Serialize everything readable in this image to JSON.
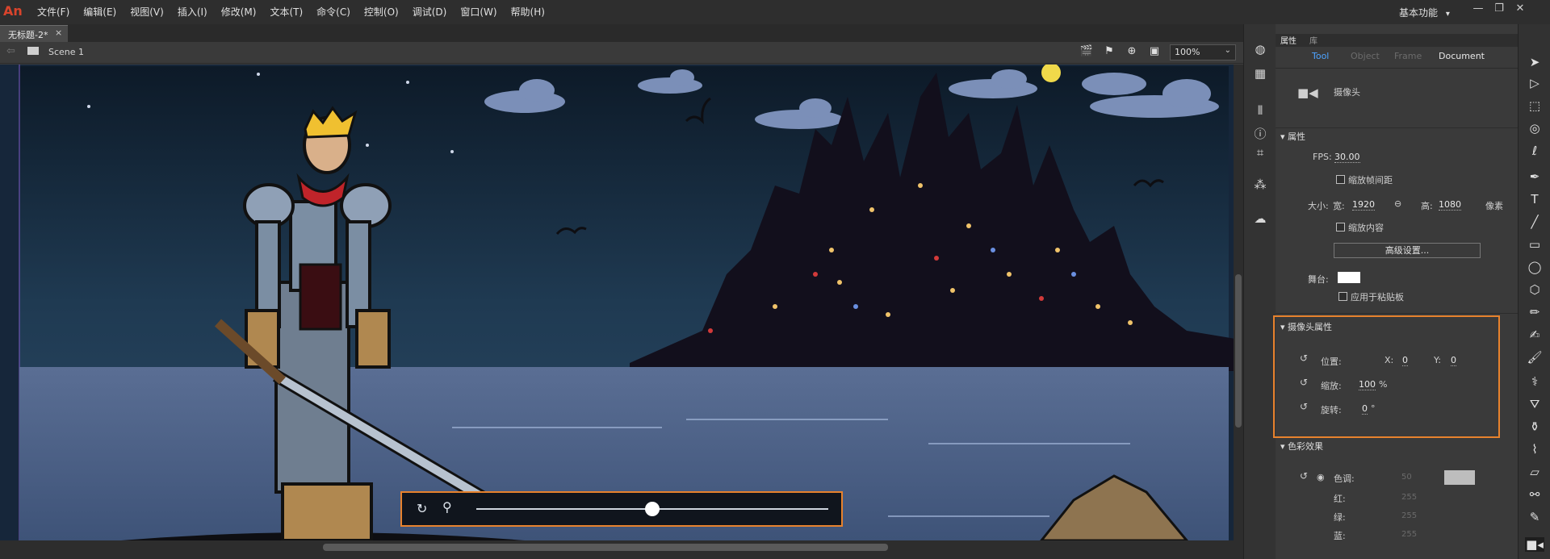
{
  "app": {
    "logo": "An"
  },
  "menu": [
    "文件(F)",
    "编辑(E)",
    "视图(V)",
    "插入(I)",
    "修改(M)",
    "文本(T)",
    "命令(C)",
    "控制(O)",
    "调试(D)",
    "窗口(W)",
    "帮助(H)"
  ],
  "workspace": {
    "label": "基本功能",
    "arrow": "▾"
  },
  "window_controls": {
    "minimize": "—",
    "restore": "❐",
    "close": "✕"
  },
  "document_tab": {
    "title": "无标题-2*",
    "close": "×"
  },
  "scene": {
    "name": "Scene 1"
  },
  "zoom": {
    "value": "100%"
  },
  "camera_slider": {
    "level": 0.5
  },
  "panel": {
    "tabs": {
      "properties": "属性",
      "library": "库"
    },
    "subtabs": [
      "Tool",
      "Object",
      "Frame",
      "Document"
    ],
    "active_subtab": "Tool",
    "tool_name": "摄像头",
    "properties_section": "属性",
    "fps_label": "FPS:",
    "fps_value": "30.00",
    "scale_span_label": "缩放帧间距",
    "size_label": "大小:",
    "width_label": "宽:",
    "width_value": "1920",
    "height_label": "高:",
    "height_value": "1080",
    "unit": "像素",
    "scale_content_label": "缩放内容",
    "advanced_button": "高级设置...",
    "stage_label": "舞台:",
    "apply_pasteboard_label": "应用于粘贴板",
    "camera_section": "摄像头属性",
    "position_label": "位置:",
    "x_label": "X:",
    "x_value": "0",
    "y_label": "Y:",
    "y_value": "0",
    "zoom_label": "缩放:",
    "zoom_value": "100",
    "zoom_unit": "%",
    "rotation_label": "旋转:",
    "rotation_value": "0",
    "rotation_unit": "°",
    "color_section": "色彩效果",
    "tint_label": "色调:",
    "tint_value": "50",
    "red_label": "红:",
    "red_value": "255",
    "green_label": "绿:",
    "green_value": "255",
    "blue_label": "蓝:",
    "blue_value": "255"
  },
  "colors": {
    "accent": "#e7822d",
    "active_tab": "#4da3ff"
  }
}
